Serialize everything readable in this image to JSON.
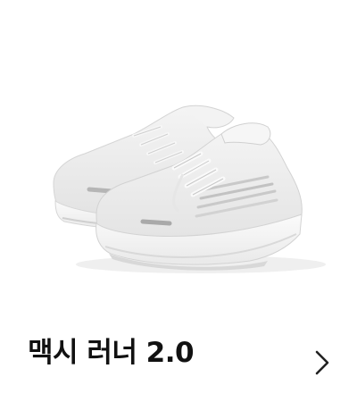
{
  "product": {
    "title": "맥시 러너 2.0",
    "image": "white-running-sneakers-pair"
  },
  "icons": {
    "chevron": "chevron-right-icon"
  },
  "colors": {
    "title": "#111111",
    "chevron": "#222222",
    "background": "#ffffff",
    "shoe": "#ededed"
  }
}
